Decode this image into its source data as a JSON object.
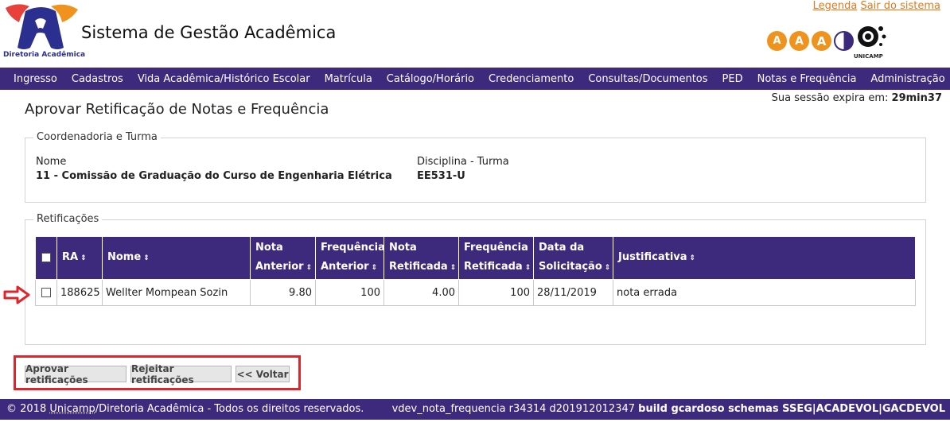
{
  "header": {
    "app_title": "Sistema de Gestão Acadêmica",
    "logo_caption": "Diretoria Acadêmica",
    "links": [
      "Legenda",
      "Sair do sistema"
    ],
    "accessibility": [
      "A",
      "A",
      "A"
    ],
    "unicamp_caption": "UNICAMP"
  },
  "menu": [
    "Ingresso",
    "Cadastros",
    "Vida Acadêmica/Histórico Escolar",
    "Matrícula",
    "Catálogo/Horário",
    "Credenciamento",
    "Consultas/Documentos",
    "PED",
    "Notas e Frequência",
    "Administração"
  ],
  "session": {
    "label": "Sua sessão expira em:",
    "value": "29min37"
  },
  "page_title": "Aprovar Retificação de Notas e Frequência",
  "coordenadoria": {
    "legend": "Coordenadoria e Turma",
    "nome_label": "Nome",
    "nome_value": "11 - Comissão de Graduação do Curso de Engenharia Elétrica",
    "disciplina_label": "Disciplina - Turma",
    "disciplina_value": "EE531-U"
  },
  "retificacoes": {
    "legend": "Retificações",
    "columns": [
      {
        "line1": "RA",
        "line2": ""
      },
      {
        "line1": "Nome",
        "line2": ""
      },
      {
        "line1": "Nota",
        "line2": "Anterior"
      },
      {
        "line1": "Frequência",
        "line2": "Anterior"
      },
      {
        "line1": "Nota",
        "line2": "Retificada"
      },
      {
        "line1": "Frequência",
        "line2": "Retificada"
      },
      {
        "line1": "Data da",
        "line2": "Solicitação"
      },
      {
        "line1": "Justificativa",
        "line2": ""
      }
    ],
    "sort_glyph": "⇕",
    "rows": [
      [
        "188625",
        "Wellter Mompean Sozin",
        "9.80",
        "100",
        "4.00",
        "100",
        "28/11/2019",
        "nota errada"
      ]
    ]
  },
  "actions": {
    "approve": "Aprovar retificações",
    "reject": "Rejeitar retificações",
    "back": "<< Voltar"
  },
  "footer": {
    "copyright_prefix": "© 2018 ",
    "copyright_link": "Unicamp",
    "copyright_suffix": "/Diretoria Acadêmica - Todos os direitos reservados.",
    "version": "vdev_nota_frequencia r34314 d201912012347",
    "build": "build gcardoso schemas SSEG|ACADEVOL|GACDEVOL"
  },
  "colors": {
    "brand_purple": "#3d2a7c",
    "link_orange": "#e07b1a",
    "accessibility_orange": "#f0931e",
    "highlight_red": "#e0242c"
  }
}
